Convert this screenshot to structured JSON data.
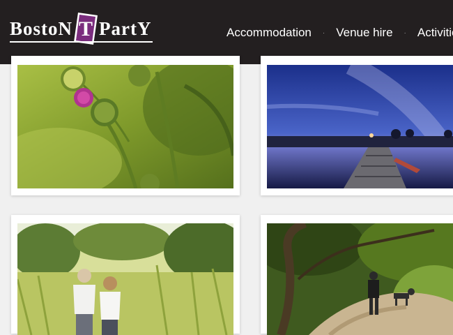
{
  "brand": {
    "word_left": "BostoN",
    "word_right": "PartY",
    "letter": "T",
    "accent_color": "#7b2d7e"
  },
  "nav": {
    "items": [
      "Accommodation",
      "Venue hire",
      "Activities"
    ],
    "separator": "·"
  },
  "gallery": {
    "photos": [
      "thistle-photo",
      "night-lake-photo",
      "couple-meadow-photo",
      "woodland-walk-photo"
    ]
  }
}
